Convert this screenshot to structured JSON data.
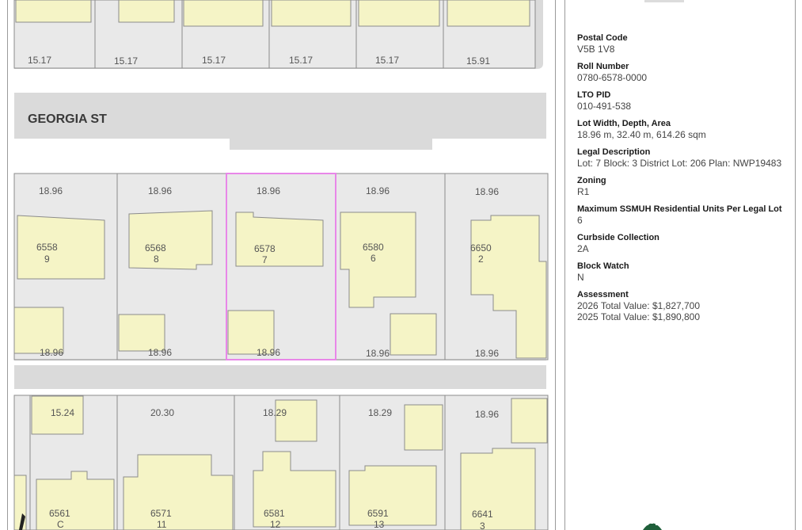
{
  "map": {
    "street_name": "GEORGIA ST",
    "selected_parcel": "6578",
    "top_row_lot_widths": [
      "15.17",
      "15.17",
      "15.17",
      "15.17",
      "15.17",
      "15.91"
    ],
    "middle_row": [
      {
        "house": "6558",
        "lot": "9",
        "front": "18.96",
        "rear": "18.96"
      },
      {
        "house": "6568",
        "lot": "8",
        "front": "18.96",
        "rear": "18.96"
      },
      {
        "house": "6578",
        "lot": "7",
        "front": "18.96",
        "rear": "18.96"
      },
      {
        "house": "6580",
        "lot": "6",
        "front": "18.96",
        "rear": "18.96"
      },
      {
        "house": "6650",
        "lot": "2",
        "front": "18.96",
        "rear": "18.96"
      }
    ],
    "bottom_row": [
      {
        "house": "6561",
        "lot": "C",
        "width": "15.24"
      },
      {
        "house": "6571",
        "lot": "11",
        "width": "20.30"
      },
      {
        "house": "6581",
        "lot": "12",
        "width": "18.29"
      },
      {
        "house": "6591",
        "lot": "13",
        "width": "18.29"
      },
      {
        "house": "6641",
        "lot": "3",
        "width": "18.96"
      }
    ],
    "colors": {
      "building": "#f5f4c6",
      "lot": "#e9e9e9",
      "road": "#dadada",
      "selected": "#e887e8",
      "line": "#8c8c8c"
    }
  },
  "property": {
    "postal_code": {
      "label": "Postal Code",
      "value": "V5B 1V8"
    },
    "roll_number": {
      "label": "Roll Number",
      "value": "0780-6578-0000"
    },
    "lto_pid": {
      "label": "LTO PID",
      "value": "010-491-538"
    },
    "lot_dims": {
      "label": "Lot Width, Depth, Area",
      "value": "18.96 m, 32.40 m, 614.26 sqm"
    },
    "legal": {
      "label": "Legal Description",
      "value": "Lot: 7 Block: 3 District Lot: 206 Plan: NWP19483"
    },
    "zoning": {
      "label": "Zoning",
      "value": "R1"
    },
    "ssmuh": {
      "label": "Maximum SSMUH Residential Units Per Legal Lot",
      "value": "6"
    },
    "curbside": {
      "label": "Curbside Collection",
      "value": "2A"
    },
    "block_watch": {
      "label": "Block Watch",
      "value": "N"
    },
    "assessment": {
      "label": "Assessment",
      "value_2026": "2026 Total Value: $1,827,700",
      "value_2025": "2025 Total Value: $1,890,800"
    }
  }
}
